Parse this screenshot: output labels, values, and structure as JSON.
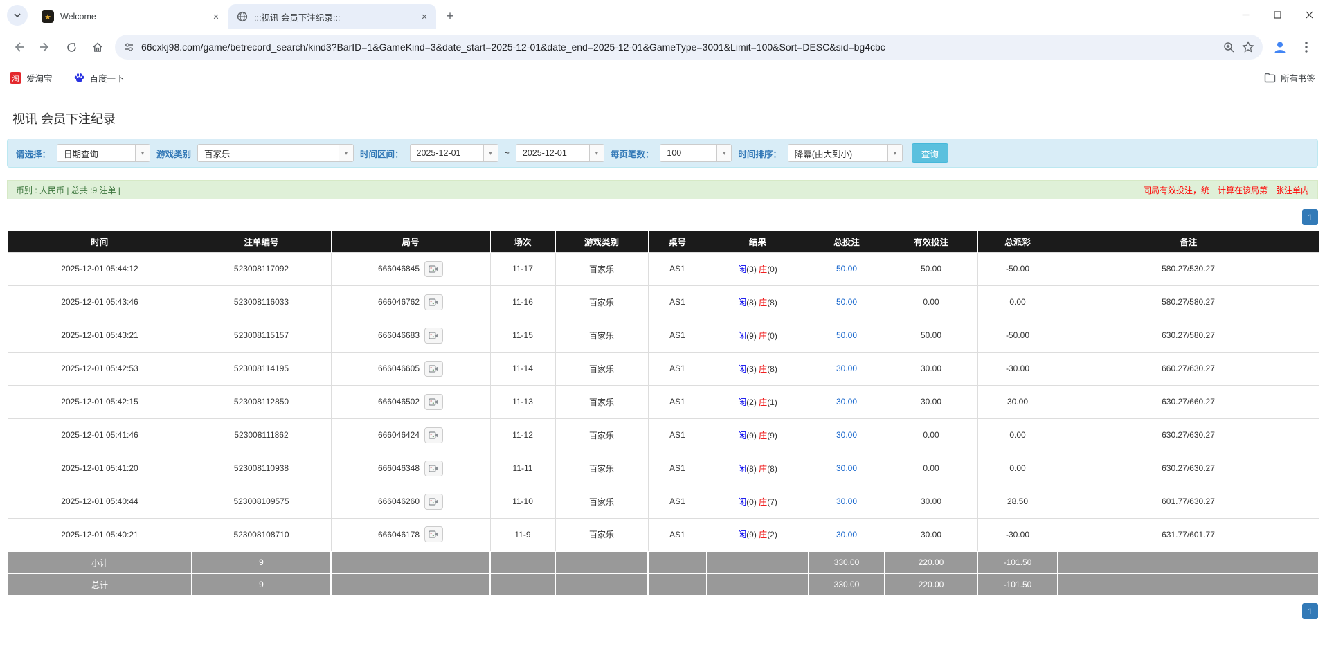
{
  "browser": {
    "tabs": [
      {
        "title": "Welcome"
      },
      {
        "title": ":::视讯 会员下注纪录:::"
      }
    ],
    "url": "66cxkj98.com/game/betrecord_search/kind3?BarID=1&GameKind=3&date_start=2025-12-01&date_end=2025-12-01&GameType=3001&Limit=100&Sort=DESC&sid=bg4cbc",
    "bookmarks": [
      {
        "label": "爱淘宝"
      },
      {
        "label": "百度一下"
      }
    ],
    "all_bookmarks_label": "所有书签"
  },
  "icons": {
    "close": "✕",
    "plus": "+",
    "caret": "▾",
    "taobao_glyph": "淘",
    "dragon_glyph": "★"
  },
  "colors": {
    "table_header_bg": "#1b1b1b",
    "table_footer_bg": "#999999",
    "filter_panel_bg": "#d9edf7",
    "info_bar_bg": "#dff0d8",
    "search_button_bg": "#5bc0de",
    "pagination_bg": "#337ab7",
    "bet_link_blue": "#1766cc",
    "player_blue": "#0000ee",
    "banker_red": "#ee0000",
    "negative_red": "#ff0000"
  },
  "page": {
    "title": "视讯 会员下注纪录",
    "filters": {
      "mode_label": "请选择：",
      "mode_value": "日期查询",
      "game_type_label": "游戏类别",
      "game_type_value": "百家乐",
      "date_range_label": "时间区间：",
      "date_start": "2025-12-01",
      "tilde": "~",
      "date_end": "2025-12-01",
      "page_size_label": "每页笔数：",
      "page_size_value": "100",
      "sort_label": "时间排序：",
      "sort_value": "降冪(由大到小)",
      "search_button": "查询"
    },
    "info_bar": {
      "left": "币别 : 人民币 | 总共 :9 注单 |",
      "right": "同局有效投注，统一计算在该局第一张注单内"
    },
    "pagination": "1",
    "table": {
      "headers": [
        "时间",
        "注单编号",
        "局号",
        "场次",
        "游戏类别",
        "桌号",
        "结果",
        "总投注",
        "有效投注",
        "总派彩",
        "备注"
      ],
      "rows": [
        {
          "time": "2025-12-01 05:44:12",
          "bet_no": "523008117092",
          "round_no": "666046845",
          "session": "11-17",
          "game": "百家乐",
          "table_no": "AS1",
          "player": "闲",
          "player_pts": "(3)",
          "banker": "庄",
          "banker_pts": "(0)",
          "total_bet": "50.00",
          "valid_bet": "50.00",
          "payout": "-50.00",
          "remark": "580.27/530.27"
        },
        {
          "time": "2025-12-01 05:43:46",
          "bet_no": "523008116033",
          "round_no": "666046762",
          "session": "11-16",
          "game": "百家乐",
          "table_no": "AS1",
          "player": "闲",
          "player_pts": "(8)",
          "banker": "庄",
          "banker_pts": "(8)",
          "total_bet": "50.00",
          "valid_bet": "0.00",
          "payout": "0.00",
          "remark": "580.27/580.27"
        },
        {
          "time": "2025-12-01 05:43:21",
          "bet_no": "523008115157",
          "round_no": "666046683",
          "session": "11-15",
          "game": "百家乐",
          "table_no": "AS1",
          "player": "闲",
          "player_pts": "(9)",
          "banker": "庄",
          "banker_pts": "(0)",
          "total_bet": "50.00",
          "valid_bet": "50.00",
          "payout": "-50.00",
          "remark": "630.27/580.27"
        },
        {
          "time": "2025-12-01 05:42:53",
          "bet_no": "523008114195",
          "round_no": "666046605",
          "session": "11-14",
          "game": "百家乐",
          "table_no": "AS1",
          "player": "闲",
          "player_pts": "(3)",
          "banker": "庄",
          "banker_pts": "(8)",
          "total_bet": "30.00",
          "valid_bet": "30.00",
          "payout": "-30.00",
          "remark": "660.27/630.27"
        },
        {
          "time": "2025-12-01 05:42:15",
          "bet_no": "523008112850",
          "round_no": "666046502",
          "session": "11-13",
          "game": "百家乐",
          "table_no": "AS1",
          "player": "闲",
          "player_pts": "(2)",
          "banker": "庄",
          "banker_pts": "(1)",
          "total_bet": "30.00",
          "valid_bet": "30.00",
          "payout": "30.00",
          "remark": "630.27/660.27"
        },
        {
          "time": "2025-12-01 05:41:46",
          "bet_no": "523008111862",
          "round_no": "666046424",
          "session": "11-12",
          "game": "百家乐",
          "table_no": "AS1",
          "player": "闲",
          "player_pts": "(9)",
          "banker": "庄",
          "banker_pts": "(9)",
          "total_bet": "30.00",
          "valid_bet": "0.00",
          "payout": "0.00",
          "remark": "630.27/630.27"
        },
        {
          "time": "2025-12-01 05:41:20",
          "bet_no": "523008110938",
          "round_no": "666046348",
          "session": "11-11",
          "game": "百家乐",
          "table_no": "AS1",
          "player": "闲",
          "player_pts": "(8)",
          "banker": "庄",
          "banker_pts": "(8)",
          "total_bet": "30.00",
          "valid_bet": "0.00",
          "payout": "0.00",
          "remark": "630.27/630.27"
        },
        {
          "time": "2025-12-01 05:40:44",
          "bet_no": "523008109575",
          "round_no": "666046260",
          "session": "11-10",
          "game": "百家乐",
          "table_no": "AS1",
          "player": "闲",
          "player_pts": "(0)",
          "banker": "庄",
          "banker_pts": "(7)",
          "total_bet": "30.00",
          "valid_bet": "30.00",
          "payout": "28.50",
          "remark": "601.77/630.27"
        },
        {
          "time": "2025-12-01 05:40:21",
          "bet_no": "523008108710",
          "round_no": "666046178",
          "session": "11-9",
          "game": "百家乐",
          "table_no": "AS1",
          "player": "闲",
          "player_pts": "(9)",
          "banker": "庄",
          "banker_pts": "(2)",
          "total_bet": "30.00",
          "valid_bet": "30.00",
          "payout": "-30.00",
          "remark": "631.77/601.77"
        }
      ],
      "subtotal": {
        "label": "小计",
        "count": "9",
        "total_bet": "330.00",
        "valid_bet": "220.00",
        "payout": "-101.50"
      },
      "total": {
        "label": "总计",
        "count": "9",
        "total_bet": "330.00",
        "valid_bet": "220.00",
        "payout": "-101.50"
      }
    }
  }
}
